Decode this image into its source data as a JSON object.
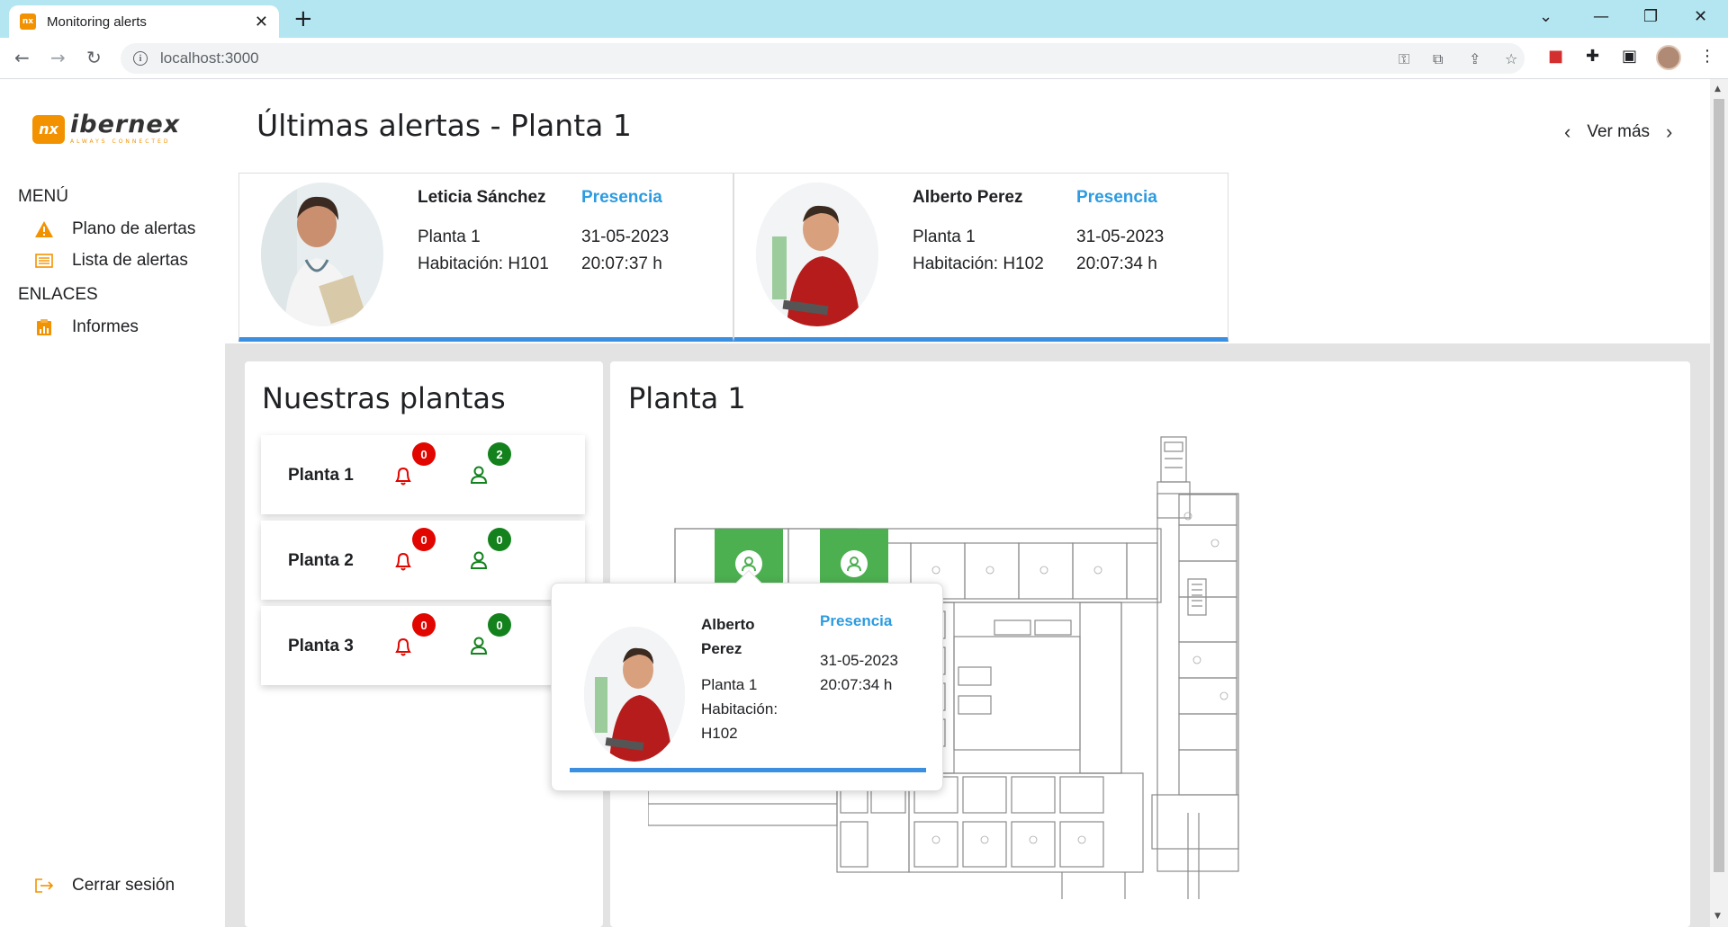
{
  "browser": {
    "tab_title": "Monitoring alerts",
    "tab_icon_text": "nx",
    "url": "localhost:3000"
  },
  "sidebar": {
    "logo_text": "ibernex",
    "logo_mark": "nx",
    "logo_sub": "ALWAYS CONNECTED",
    "menu_heading": "MENÚ",
    "menu_items": [
      {
        "label": "Plano de alertas",
        "icon": "warning-icon"
      },
      {
        "label": "Lista de alertas",
        "icon": "list-icon"
      }
    ],
    "links_heading": "ENLACES",
    "link_items": [
      {
        "label": "Informes",
        "icon": "report-icon"
      }
    ],
    "logout_label": "Cerrar sesión"
  },
  "header": {
    "title": "Últimas alertas - Planta 1",
    "ver_mas": "Ver más"
  },
  "alerts": [
    {
      "name": "Leticia Sánchez",
      "type": "Presencia",
      "floor": "Planta 1",
      "room": "Habitación: H101",
      "date": "31-05-2023",
      "time": "20:07:37 h"
    },
    {
      "name": "Alberto Perez",
      "type": "Presencia",
      "floor": "Planta 1",
      "room": "Habitación: H102",
      "date": "31-05-2023",
      "time": "20:07:34 h"
    }
  ],
  "plants_panel": {
    "title": "Nuestras plantas",
    "floors": [
      {
        "name": "Planta 1",
        "alerts": "0",
        "people": "2"
      },
      {
        "name": "Planta 2",
        "alerts": "0",
        "people": "0"
      },
      {
        "name": "Planta 3",
        "alerts": "0",
        "people": "0"
      }
    ]
  },
  "plan_panel": {
    "title": "Planta 1"
  },
  "popup": {
    "name": "Alberto Perez",
    "type": "Presencia",
    "date": "31-05-2023",
    "time": "20:07:34 h",
    "floor": "Planta 1",
    "room_label": "Habitación:",
    "room": "H102"
  },
  "colors": {
    "accent_blue": "#3b8fe0",
    "presence_blue": "#2c9be0",
    "alert_red": "#e10600",
    "presence_green": "#13821d",
    "room_green": "#4caf50",
    "brand_orange": "#f39200"
  }
}
